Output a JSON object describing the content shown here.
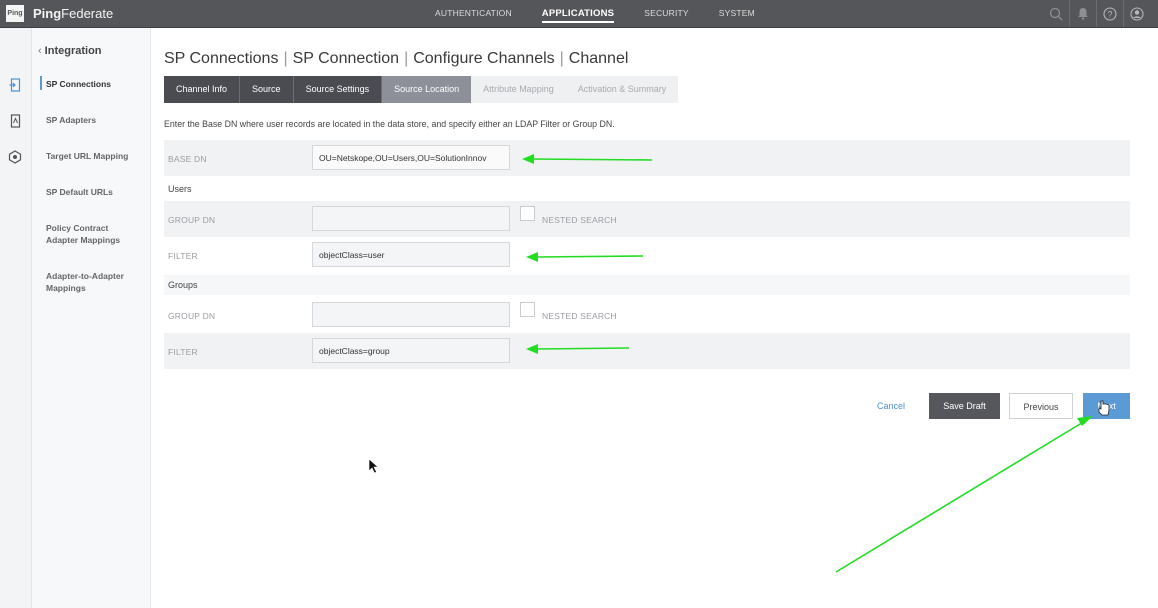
{
  "app": {
    "logo_text": "Ping",
    "name_bold": "Ping",
    "name_rest": "Federate"
  },
  "topnav": {
    "items": [
      {
        "label": "AUTHENTICATION"
      },
      {
        "label": "APPLICATIONS"
      },
      {
        "label": "SECURITY"
      },
      {
        "label": "SYSTEM"
      }
    ],
    "active": "APPLICATIONS",
    "icons": [
      "search-icon",
      "bell-icon",
      "help-icon",
      "user-icon"
    ]
  },
  "rail": {
    "icons": [
      "applications-icon",
      "adapters-icon",
      "policy-icon"
    ]
  },
  "subnav": {
    "back_chevron": "‹",
    "title": "Integration",
    "items": [
      {
        "label": "SP Connections",
        "active": true
      },
      {
        "label": "SP Adapters"
      },
      {
        "label": "Target URL Mapping"
      },
      {
        "label": "SP Default URLs"
      },
      {
        "label": "Policy Contract Adapter Mappings"
      },
      {
        "label": "Adapter-to-Adapter Mappings"
      }
    ]
  },
  "breadcrumb": [
    "SP Connections",
    "SP Connection",
    "Configure Channels",
    "Channel"
  ],
  "tabs": [
    {
      "label": "Channel Info",
      "state": "done"
    },
    {
      "label": "Source",
      "state": "done"
    },
    {
      "label": "Source Settings",
      "state": "done"
    },
    {
      "label": "Source Location",
      "state": "current"
    },
    {
      "label": "Attribute Mapping",
      "state": "future"
    },
    {
      "label": "Activation & Summary",
      "state": "future"
    }
  ],
  "intro": "Enter the Base DN where user records are located in the data store, and specify either an LDAP Filter or Group DN.",
  "form": {
    "base_dn": {
      "label": "BASE DN",
      "value": "OU=Netskope,OU=Users,OU=SolutionInnov"
    },
    "users_section": "Users",
    "users_group_dn": {
      "label": "GROUP DN",
      "value": "",
      "nested_label": "NESTED SEARCH",
      "nested_checked": false
    },
    "users_filter": {
      "label": "FILTER",
      "value": "objectClass=user"
    },
    "groups_section": "Groups",
    "groups_group_dn": {
      "label": "GROUP DN",
      "value": "",
      "nested_label": "NESTED SEARCH",
      "nested_checked": false
    },
    "groups_filter": {
      "label": "FILTER",
      "value": "objectClass=group"
    }
  },
  "actions": {
    "cancel": "Cancel",
    "save_draft": "Save Draft",
    "previous": "Previous",
    "next": "Next"
  },
  "colors": {
    "topbar": "#55565a",
    "tab_done": "#4a4c52",
    "tab_current": "#8d9099",
    "accent": "#5a9bd6",
    "annotation_arrow": "#22dd22"
  }
}
